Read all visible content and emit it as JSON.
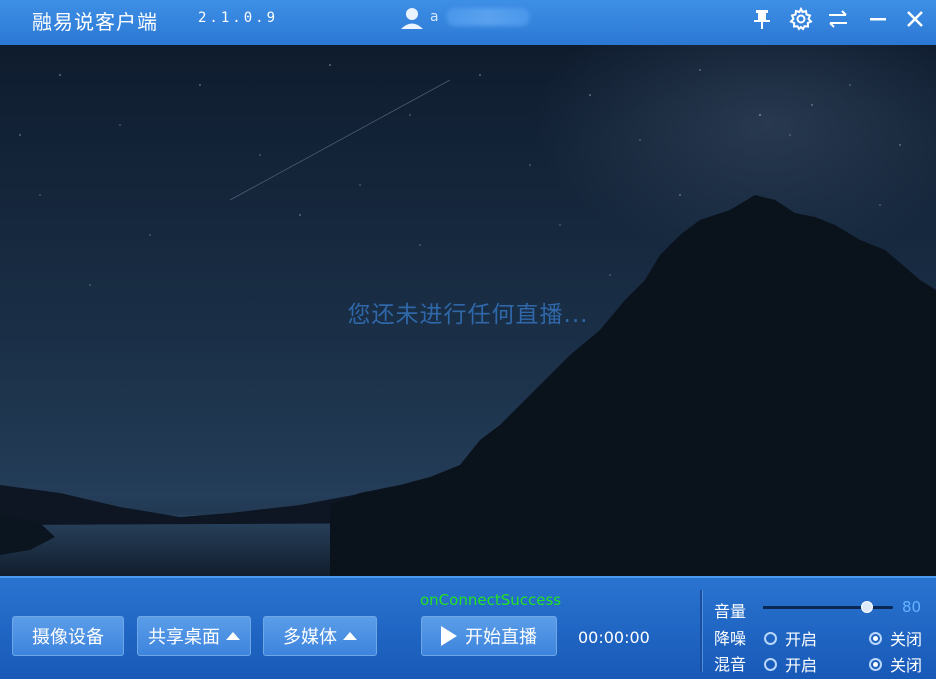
{
  "window": {
    "title": "融易说客户端",
    "version": "2.1.0.9",
    "user_name": "a"
  },
  "toolbar_icons": [
    "pin-icon",
    "gear-icon",
    "swap-icon",
    "minimize-icon",
    "close-icon"
  ],
  "stage": {
    "empty_message": "您还未进行任何直播..."
  },
  "controls": {
    "camera_label": "摄像设备",
    "share_desktop_label": "共享桌面",
    "multimedia_label": "多媒体",
    "start_live_label": "开始直播",
    "status_text": "onConnectSuccess",
    "timer": "00:00:00"
  },
  "audio": {
    "volume_label": "音量",
    "volume": 80,
    "volume_display": "80",
    "noise_label": "降噪",
    "mix_label": "混音",
    "on_label": "开启",
    "off_label": "关闭",
    "noise_on": false,
    "mix_on": false
  },
  "colors": {
    "titlebar": "#2b78d4",
    "bottombar": "#1c5fbd",
    "status_green": "#22e322",
    "volume_value": "#66b4ff",
    "empty_message": "#2f67a8"
  }
}
